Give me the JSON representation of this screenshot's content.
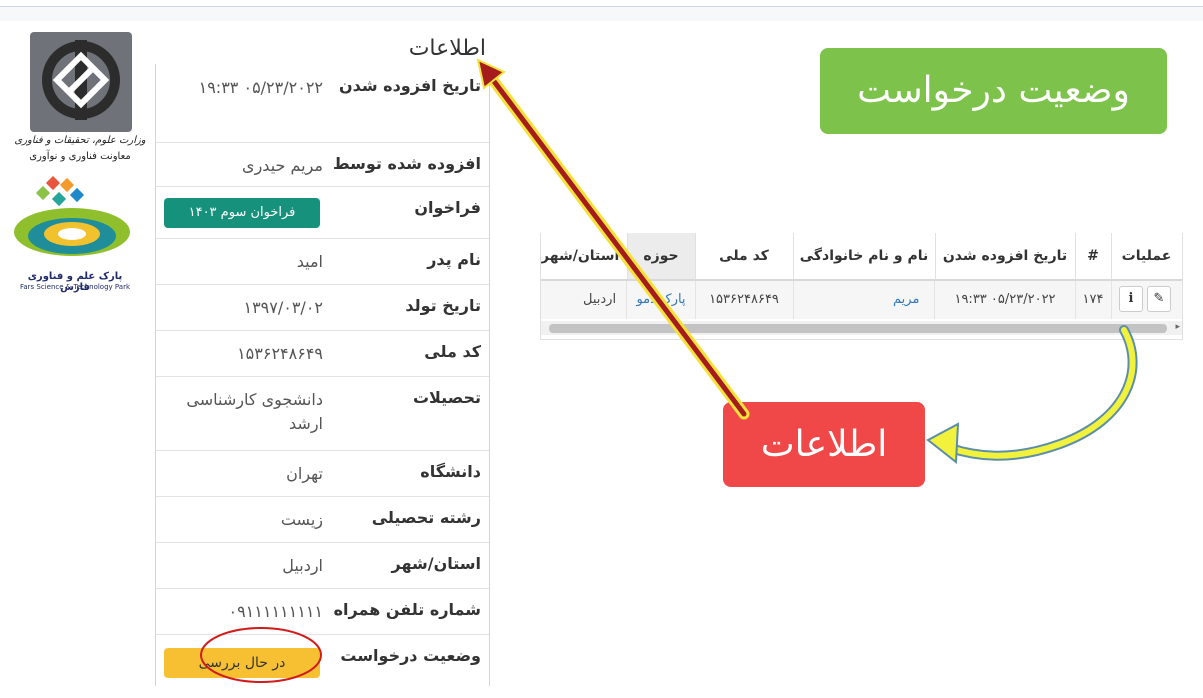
{
  "logos": {
    "ministry_caption_1": "وزارت علوم، تحقیقات و فناوری",
    "ministry_caption_2": "معاونت فناوری و نوآوری",
    "park_caption_fa": "پارک علم و فناوری فارس",
    "park_caption_en": "Fars Science & Technology Park"
  },
  "panel": {
    "title": "اطلاعات",
    "rows": [
      {
        "label": "تاریخ افزوده شدن",
        "value": "۰۵/۲۳/۲۰۲۲ ۱۹:۳۳"
      },
      {
        "label": "افزوده شده توسط",
        "value": "مریم حیدری"
      },
      {
        "label": "فراخوان",
        "value": "فراخوان سوم ۱۴۰۳"
      },
      {
        "label": "نام پدر",
        "value": "امید"
      },
      {
        "label": "تاریخ تولد",
        "value": "۱۳۹۷/۰۳/۰۲"
      },
      {
        "label": "کد ملی",
        "value": "۱۵۳۶۲۴۸۶۴۹"
      },
      {
        "label": "تحصیلات",
        "value": "دانشجوی کارشناسی ارشد"
      },
      {
        "label": "دانشگاه",
        "value": "تهران"
      },
      {
        "label": "رشته تحصیلی",
        "value": "زیست"
      },
      {
        "label": "استان/شهر",
        "value": "اردبیل"
      },
      {
        "label": "شماره تلفن همراه",
        "value": "۰۹۱۱۱۱۱۱۱۱۱"
      },
      {
        "label": "وضعیت درخواست",
        "value": "در حال بررسی"
      }
    ]
  },
  "status_banner": "وضعیت درخواست",
  "info_banner": "اطلاعات",
  "table": {
    "headers": {
      "ops": "عملیات",
      "num": "#",
      "date": "تاریخ افزوده شدن",
      "name": "نام و نام خانوادگی",
      "code": "کد ملی",
      "domain": "حوزه",
      "city": "استان/شهر"
    },
    "row": {
      "num": "۱۷۴",
      "date": "۱۹:۳۳ ۰۵/۲۳/۲۰۲۲",
      "name": "مریم",
      "code": "۱۵۳۶۲۴۸۶۴۹",
      "domain": "پارک دمو",
      "city": "اردبیل"
    }
  },
  "icons": {
    "edit": "edit-icon",
    "info": "info-icon"
  },
  "colors": {
    "status_banner": "#7cc24b",
    "info_banner": "#f04848",
    "call_badge": "#16917c",
    "status_badge": "#f7c033"
  }
}
